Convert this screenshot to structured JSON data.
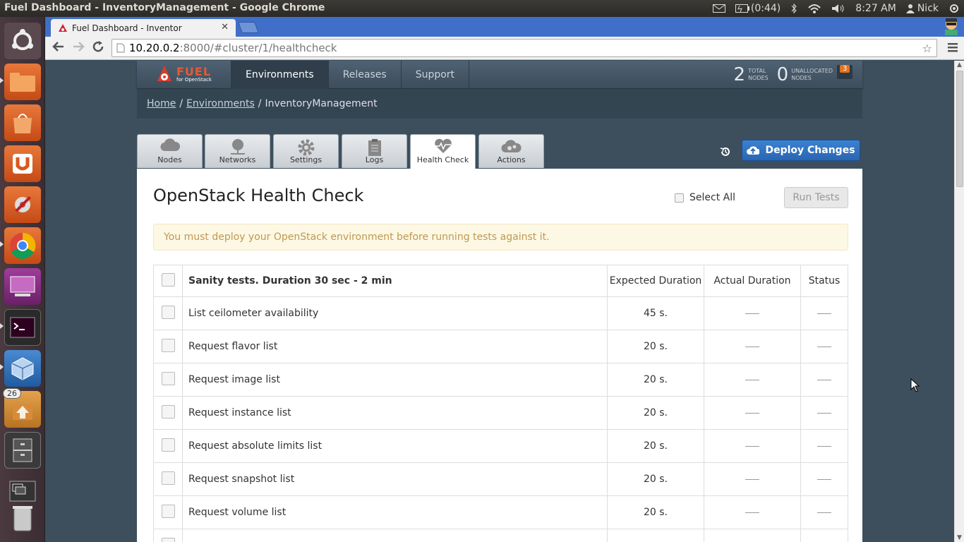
{
  "os": {
    "window_title": "Fuel Dashboard - InventoryManagement - Google Chrome",
    "battery": "(0:44)",
    "time": "8:27 AM",
    "user": "Nick",
    "launcher_badge": "26"
  },
  "browser": {
    "tab_title": "Fuel Dashboard - Inventor",
    "url_host": "10.20.0.2",
    "url_rest": ":8000/#cluster/1/healthcheck"
  },
  "nav": {
    "logo_word": "FUEL",
    "logo_sub": "for OpenStack",
    "items": [
      "Environments",
      "Releases",
      "Support"
    ],
    "total_nodes": "2",
    "total_label_1": "TOTAL",
    "total_label_2": "NODES",
    "unallocated_nodes": "0",
    "unallocated_label_1": "UNALLOCATED",
    "unallocated_label_2": "NODES",
    "notifications": "3"
  },
  "breadcrumb": {
    "home": "Home",
    "environments": "Environments",
    "current": "InventoryManagement",
    "sep": "/"
  },
  "tabs": [
    "Nodes",
    "Networks",
    "Settings",
    "Logs",
    "Health Check",
    "Actions"
  ],
  "deploy_label": "Deploy Changes",
  "healthcheck": {
    "title": "OpenStack Health Check",
    "select_all": "Select All",
    "run_tests": "Run Tests",
    "warning": "You must deploy your OpenStack environment before running tests against it.",
    "group_title": "Sanity tests. Duration 30 sec - 2 min",
    "col_expected": "Expected Duration",
    "col_actual": "Actual Duration",
    "col_status": "Status",
    "rows": [
      {
        "name": "List ceilometer availability",
        "expected": "45 s."
      },
      {
        "name": "Request flavor list",
        "expected": "20 s."
      },
      {
        "name": "Request image list",
        "expected": "20 s."
      },
      {
        "name": "Request instance list",
        "expected": "20 s."
      },
      {
        "name": "Request absolute limits list",
        "expected": "20 s."
      },
      {
        "name": "Request snapshot list",
        "expected": "20 s."
      },
      {
        "name": "Request volume list",
        "expected": "20 s."
      }
    ]
  }
}
